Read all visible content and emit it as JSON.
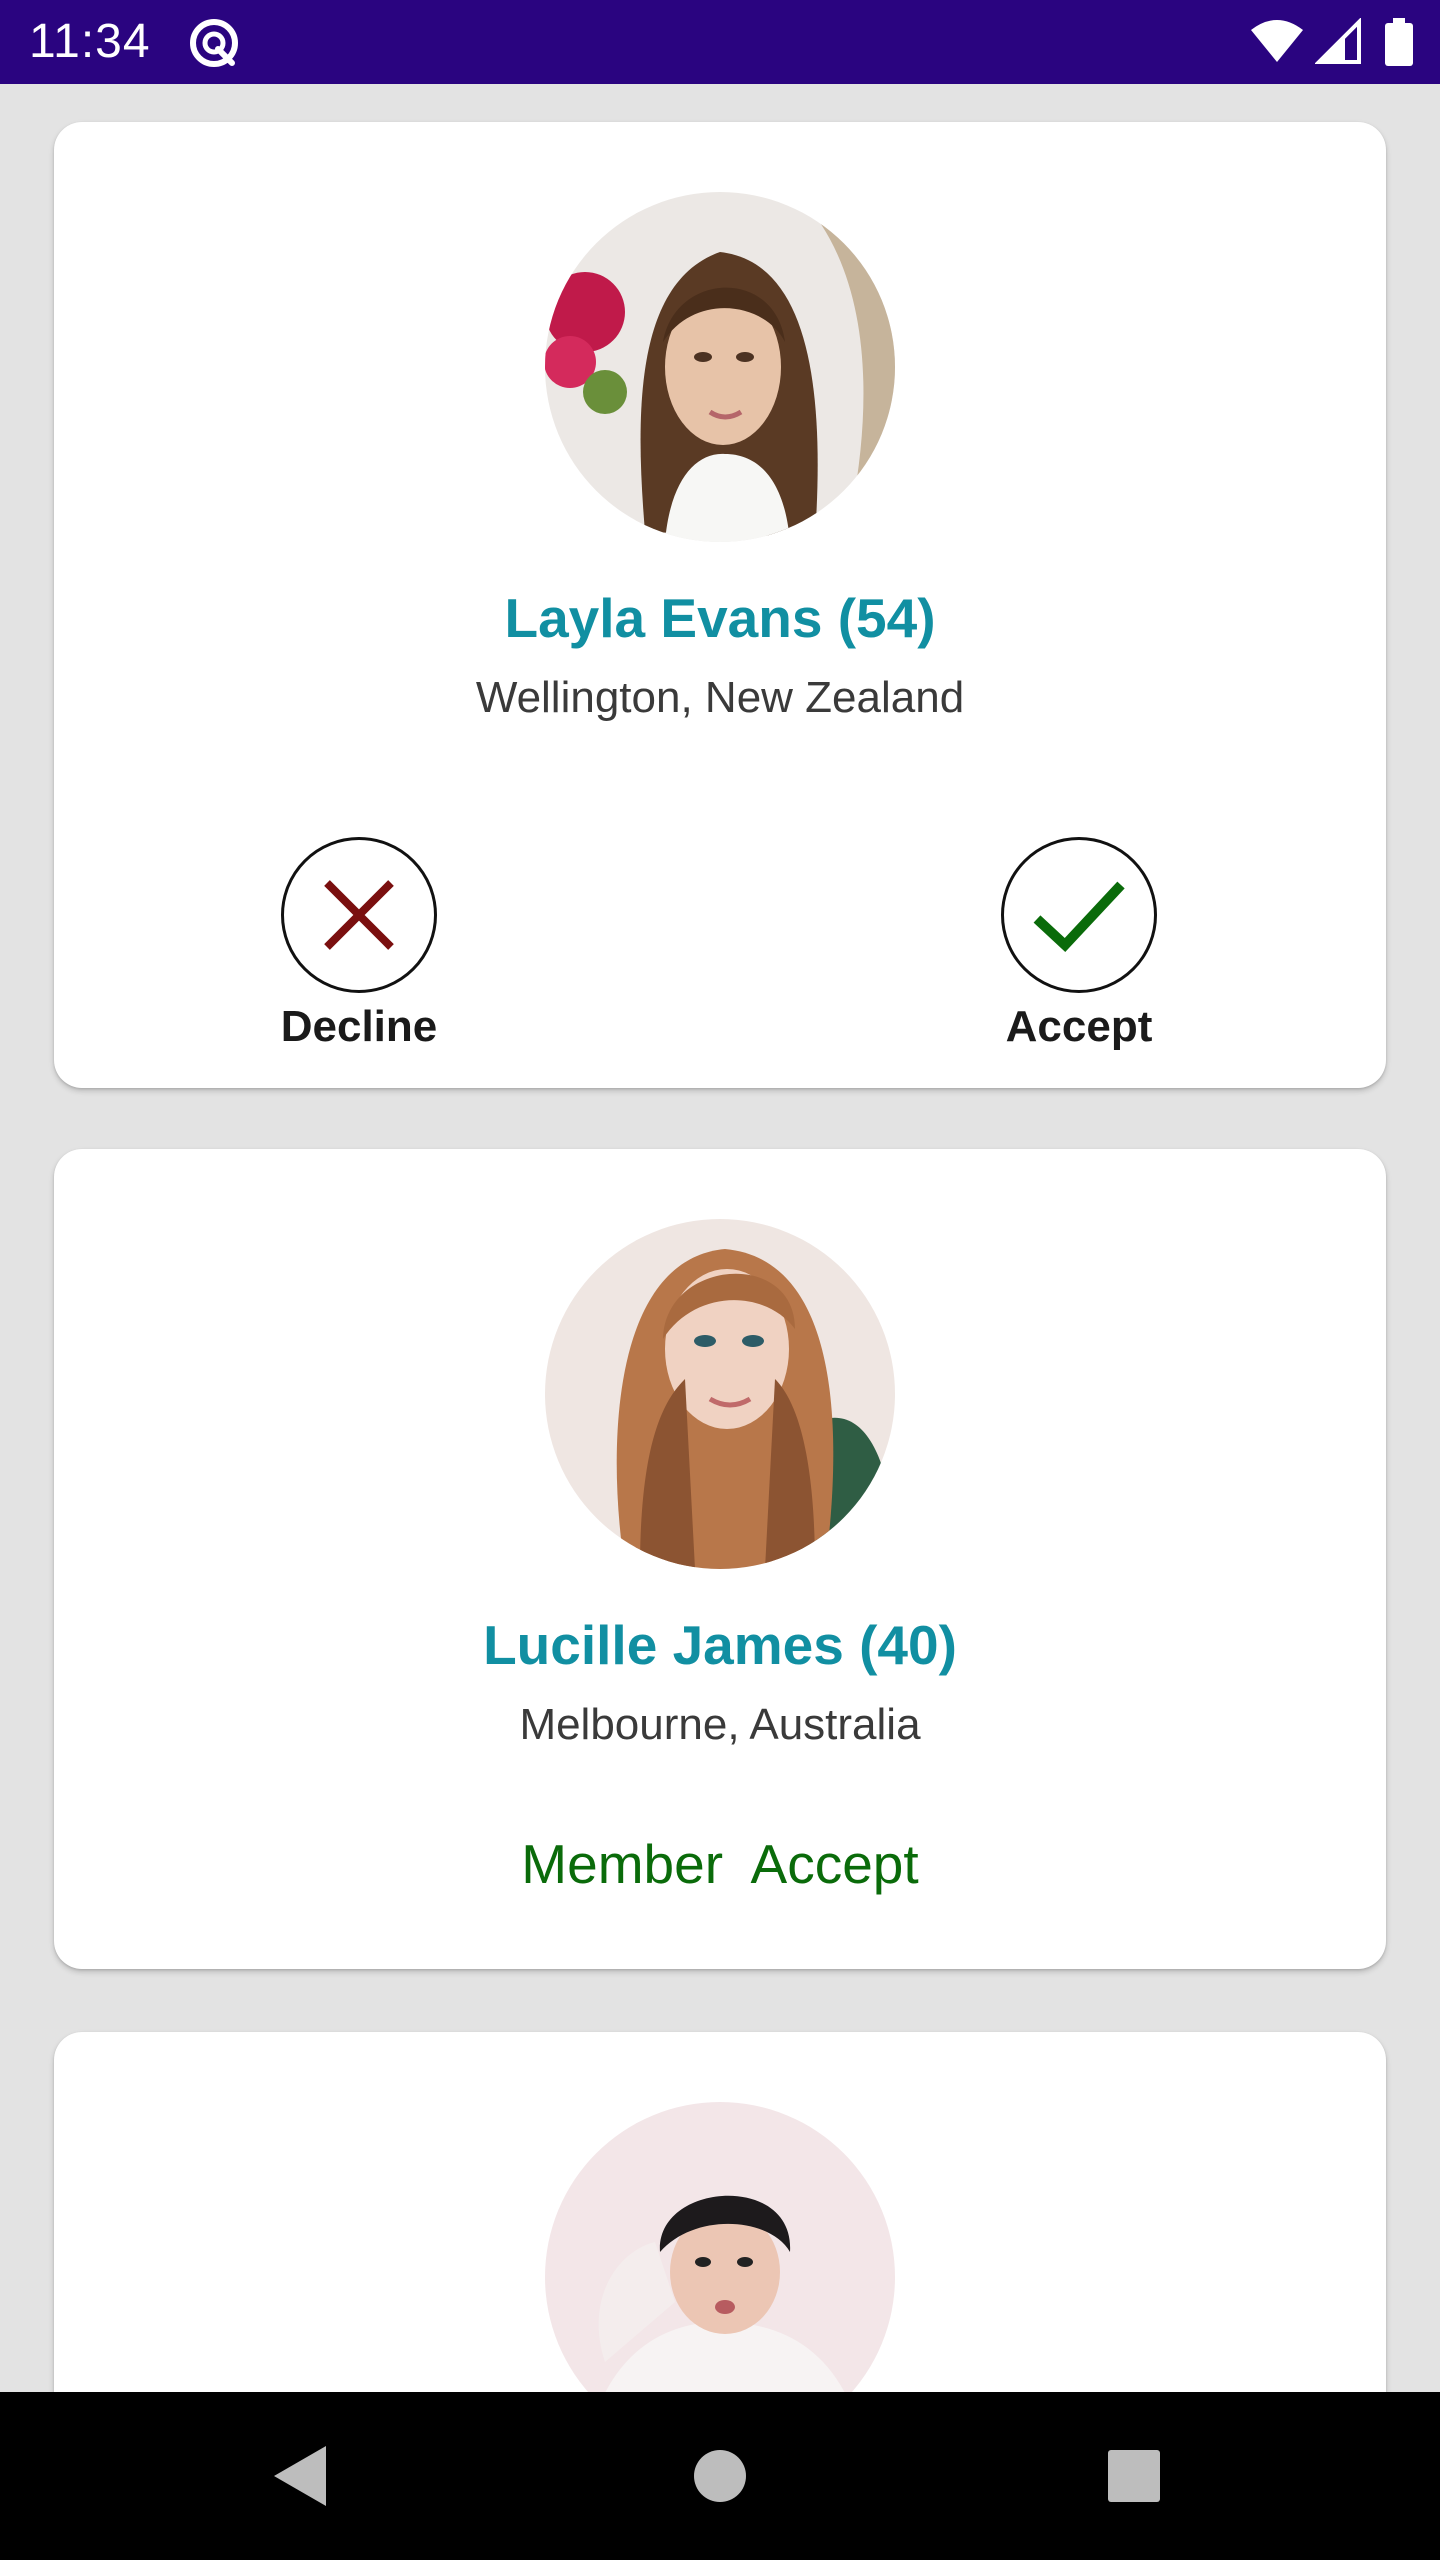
{
  "status_bar": {
    "time": "11:34",
    "icons": [
      "app-notification-icon",
      "wifi-icon",
      "cellular-signal-icon",
      "battery-icon"
    ],
    "background": "#2a0480"
  },
  "requests": [
    {
      "name": "Layla Evans (54)",
      "location": "Wellington, New Zealand",
      "decline_label": "Decline",
      "accept_label": "Accept"
    },
    {
      "name": "Lucille James (40)",
      "location": "Melbourne, Australia",
      "status_label": "Member  Accept"
    },
    {
      "name": "",
      "location": ""
    }
  ],
  "colors": {
    "name_text": "#118fa2",
    "decline_icon": "#7a0f0f",
    "accept_icon": "#0a6b0a",
    "member_accept_text": "#0a6b0a"
  },
  "nav_bar": {
    "buttons": [
      "back-icon",
      "home-icon",
      "recents-icon"
    ]
  }
}
